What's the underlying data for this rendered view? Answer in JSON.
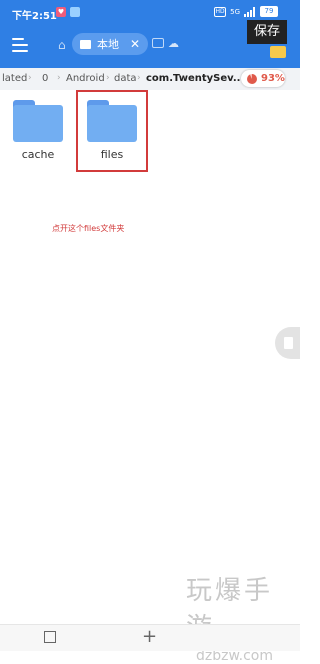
{
  "status_bar": {
    "time": "下午2:51",
    "badge_left": "♥",
    "network": "5G",
    "volte": "HD",
    "battery": "79"
  },
  "header": {
    "menu_icon": "menu-icon",
    "local_tab_label": "本地",
    "close_symbol": "✕",
    "save_label": "保存"
  },
  "breadcrumb": {
    "items": [
      "lated",
      "0",
      "Android",
      "data",
      "com.TwentySev..."
    ],
    "separator": "›",
    "storage_percent": "93%"
  },
  "files": [
    {
      "name": "cache"
    },
    {
      "name": "files"
    }
  ],
  "annotation_text": "点开这个files文件夹",
  "watermark": {
    "text": "玩爆手游",
    "url": "dzbzw.com"
  },
  "colors": {
    "header_blue": "#2f7fe4",
    "folder_blue": "#72aef2",
    "highlight_red": "#d23b3b",
    "storage_red": "#e05a4b"
  }
}
